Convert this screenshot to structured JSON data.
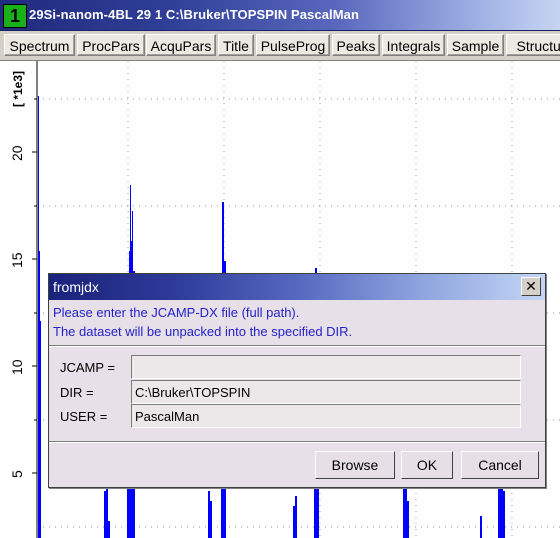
{
  "window": {
    "number": "1",
    "title": "29Si-nanom-4BL  29  1  C:\\Bruker\\TOPSPIN  PascalMan"
  },
  "tabs": [
    "Spectrum",
    "ProcPars",
    "AcquPars",
    "Title",
    "PulseProg",
    "Peaks",
    "Integrals",
    "Sample",
    "Structur"
  ],
  "plot": {
    "unit_label": "[ *1e3]",
    "y_ticks": [
      "20",
      "15",
      "10",
      "5"
    ],
    "spectrum_color": "#0000ff"
  },
  "dialog": {
    "title": "fromjdx",
    "close_symbol": "✕",
    "message_line1": "Please enter the JCAMP-DX file (full path).",
    "message_line2": "The dataset will be unpacked into the specified DIR.",
    "fields": {
      "jcamp_label": "JCAMP =",
      "jcamp_value": "",
      "dir_label": "DIR =",
      "dir_value": "C:\\Bruker\\TOPSPIN",
      "user_label": "USER =",
      "user_value": "PascalMan"
    },
    "buttons": {
      "browse": "Browse",
      "ok": "OK",
      "cancel": "Cancel"
    }
  }
}
